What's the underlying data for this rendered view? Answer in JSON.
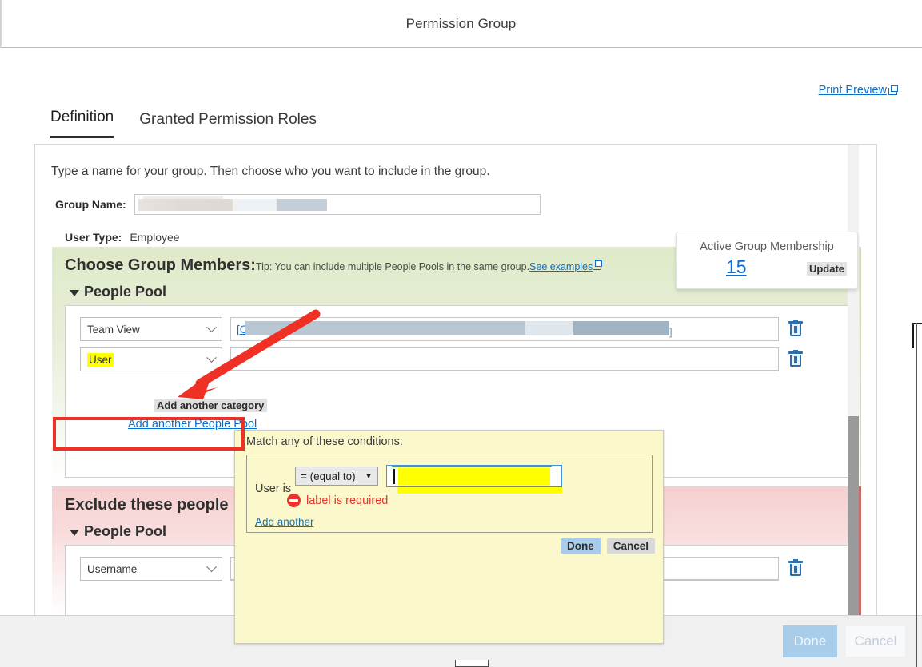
{
  "window": {
    "title": "Permission Group"
  },
  "header": {
    "print_preview": "Print Preview"
  },
  "tabs": [
    {
      "label": "Definition",
      "active": true
    },
    {
      "label": "Granted Permission Roles",
      "active": false
    }
  ],
  "form": {
    "intro": "Type a name for your group. Then choose who you want to include in the group.",
    "group_name_label": "Group Name:",
    "group_name_value": "",
    "user_type_label": "User Type:",
    "user_type_value": "Employee"
  },
  "membership_card": {
    "title": "Active Group Membership",
    "count": "15",
    "update_label": "Update"
  },
  "include_section": {
    "title": "Choose Group Members:",
    "tip_text": "Tip: You can include multiple People Pools in the same group.",
    "tip_link": "See examples",
    "pool_label": "People Pool",
    "rows": [
      {
        "category": "Team View",
        "value_prefix": "[C",
        "value_suffix": "]"
      },
      {
        "category": "User",
        "value_prefix": "",
        "value_suffix": ""
      }
    ],
    "add_category_label": "Add another category",
    "add_pool_label": "Add another People Pool"
  },
  "condition_popup": {
    "title": "Match any of these conditions:",
    "subject_label": "User is",
    "operator": "= (equal to)",
    "input_value": "",
    "error_text": "label is required",
    "add_another_label": "Add another",
    "done_label": "Done",
    "cancel_label": "Cancel"
  },
  "exclude_section": {
    "title": "Exclude these people",
    "pool_label": "People Pool",
    "rows": [
      {
        "category": "Username",
        "value_prefix": "",
        "value_suffix": ""
      }
    ]
  },
  "footer": {
    "done_label": "Done",
    "cancel_label": "Cancel"
  },
  "icons": {
    "external_link": "external-link-icon",
    "delete": "trash-icon",
    "chevron": "chevron-down-icon",
    "caret": "caret-down-icon",
    "error": "error-stop-icon"
  },
  "colors": {
    "accent_blue": "#0a6ed1",
    "error_red": "#e8342a",
    "annotation_red": "#ee3124",
    "highlight_yellow": "#ffff00",
    "green_section": "#dfeac9",
    "red_section": "#f6cfcf",
    "popup_yellow": "#fbf8cc"
  }
}
